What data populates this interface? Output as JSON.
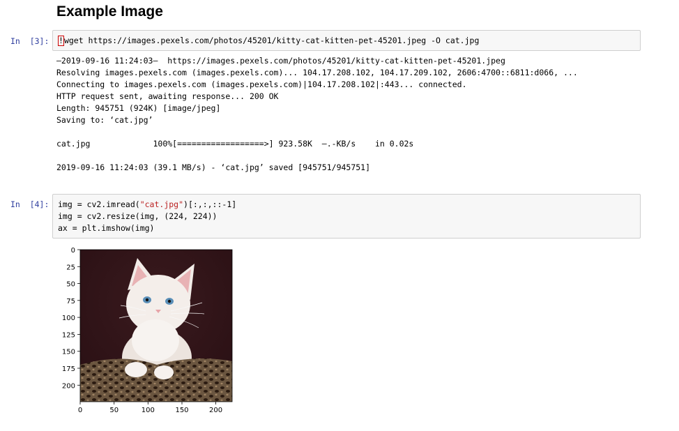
{
  "heading": "Example Image",
  "cells": [
    {
      "prompt": "In  [3]:",
      "cursor_char": "!",
      "code": "wget https://images.pexels.com/photos/45201/kitty-cat-kitten-pet-45201.jpeg -O cat.jpg",
      "output_lines": [
        "—2019-09-16 11:24:03—  https://images.pexels.com/photos/45201/kitty-cat-kitten-pet-45201.jpeg",
        "Resolving images.pexels.com (images.pexels.com)... 104.17.208.102, 104.17.209.102, 2606:4700::6811:d066, ...",
        "Connecting to images.pexels.com (images.pexels.com)|104.17.208.102|:443... connected.",
        "HTTP request sent, awaiting response... 200 OK",
        "Length: 945751 (924K) [image/jpeg]",
        "Saving to: ‘cat.jpg’",
        "",
        "cat.jpg             100%[==================>] 923.58K  —.-KB/s    in 0.02s",
        "",
        "2019-09-16 11:24:03 (39.1 MB/s) - ‘cat.jpg’ saved [945751/945751]"
      ]
    },
    {
      "prompt": "In  [4]:",
      "line1_pre": "img = cv2.imread(",
      "line1_str": "\"cat.jpg\"",
      "line1_post": ")[:,:,::-1]",
      "line2": "img = cv2.resize(img, (224, 224))",
      "line3": "ax = plt.imshow(img)"
    }
  ],
  "figure": {
    "image_subject": "white kitten on leopard-print blanket",
    "y_ticks": [
      "0",
      "25",
      "50",
      "75",
      "100",
      "125",
      "150",
      "175",
      "200"
    ],
    "x_ticks": [
      "0",
      "50",
      "100",
      "150",
      "200"
    ],
    "colors": {
      "background_dark": "#2a1014",
      "fur": "#f4eeea",
      "blanket": "#6b5640",
      "eye": "#5a8fb8",
      "ear_inner": "#e8b2b4"
    }
  }
}
